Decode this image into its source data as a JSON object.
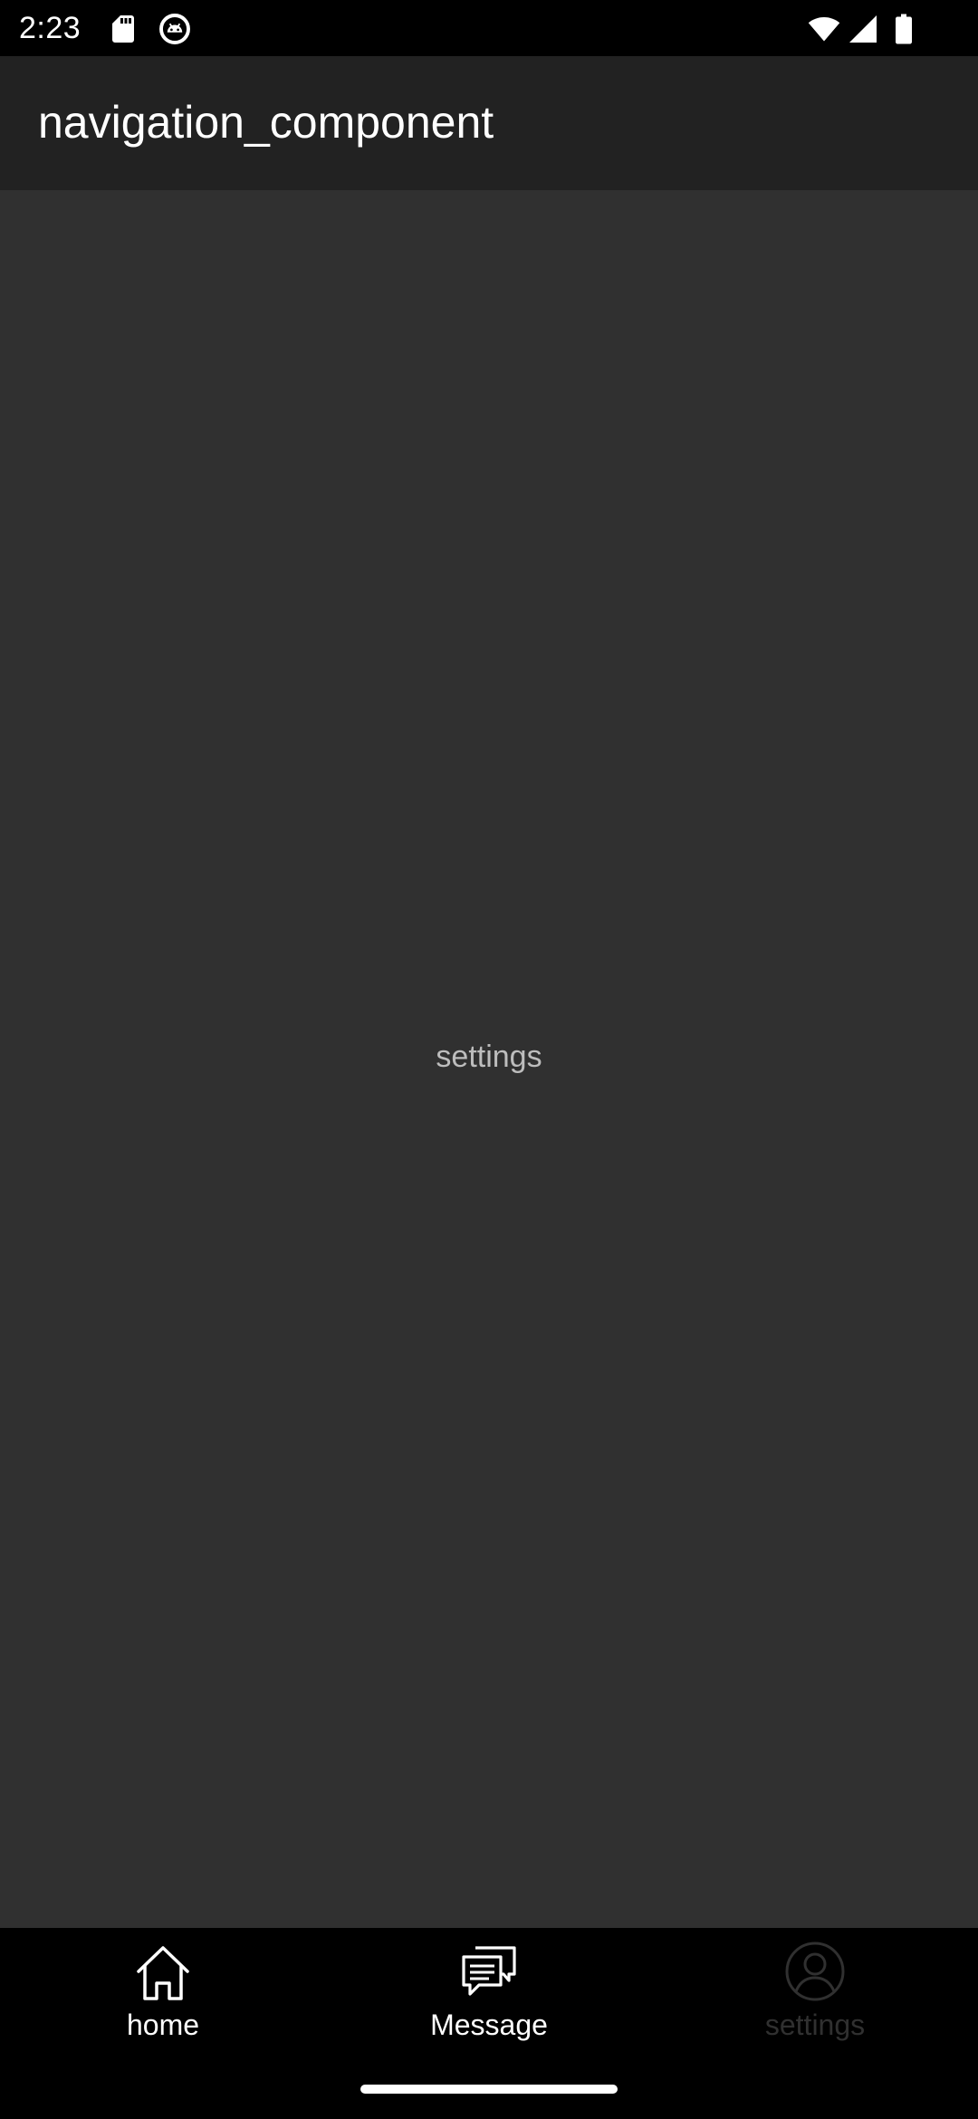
{
  "status_bar": {
    "time": "2:23",
    "left_icons": [
      "sd-card-icon",
      "android-debug-icon"
    ],
    "right_icons": [
      "wifi-icon",
      "cell-signal-icon",
      "battery-icon"
    ]
  },
  "app_bar": {
    "title": "navigation_component"
  },
  "content": {
    "text": "settings"
  },
  "bottom_nav": {
    "selected": "settings",
    "items": [
      {
        "label": "home",
        "icon": "home-icon"
      },
      {
        "label": "Message",
        "icon": "message-icon"
      },
      {
        "label": "settings",
        "icon": "account-circle-icon"
      }
    ]
  },
  "colors": {
    "status_bar_bg": "#000000",
    "app_bar_bg": "#222222",
    "content_bg": "#303030",
    "bottom_nav_bg": "#000000",
    "nav_active": "#ffffff",
    "nav_selected_dim": "#303030"
  }
}
